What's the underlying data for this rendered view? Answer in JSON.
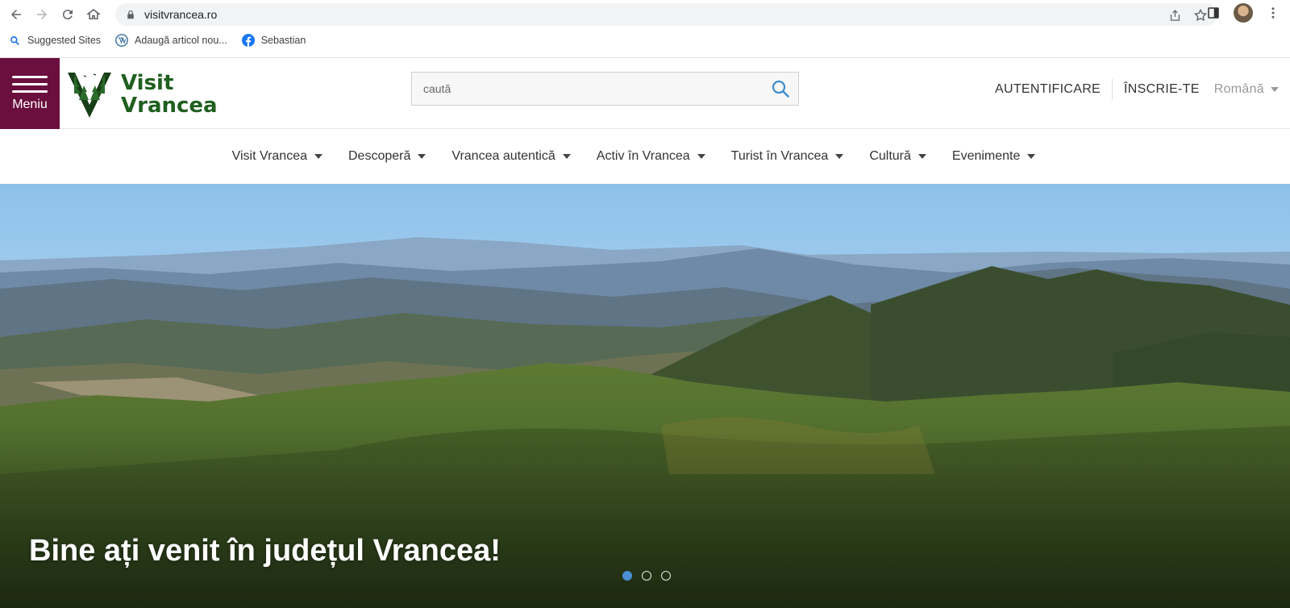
{
  "browser": {
    "url": "visitvrancea.ro",
    "bookmarks": [
      {
        "label": "Suggested Sites",
        "icon": "search-icon"
      },
      {
        "label": "Adaugă articol nou...",
        "icon": "wordpress-icon"
      },
      {
        "label": "Sebastian",
        "icon": "facebook-icon"
      }
    ]
  },
  "header": {
    "menu_label": "Meniu",
    "logo_line1": "Visit",
    "logo_line2": "Vrancea",
    "search_placeholder": "caută",
    "login": "AUTENTIFICARE",
    "signup": "ÎNSCRIE-TE",
    "language": "Română"
  },
  "nav": {
    "items": [
      {
        "label": "Visit Vrancea"
      },
      {
        "label": "Descoperă"
      },
      {
        "label": "Vrancea autentică"
      },
      {
        "label": "Activ în Vrancea"
      },
      {
        "label": "Turist în Vrancea"
      },
      {
        "label": "Cultură"
      },
      {
        "label": "Evenimente"
      }
    ]
  },
  "hero": {
    "title": "Bine ați venit în județul Vrancea!",
    "slides": 3,
    "active_slide": 1
  },
  "colors": {
    "brand": "#6a0f3e",
    "logo_green": "#1f5f1f",
    "dot_active": "#4a8fd6"
  }
}
